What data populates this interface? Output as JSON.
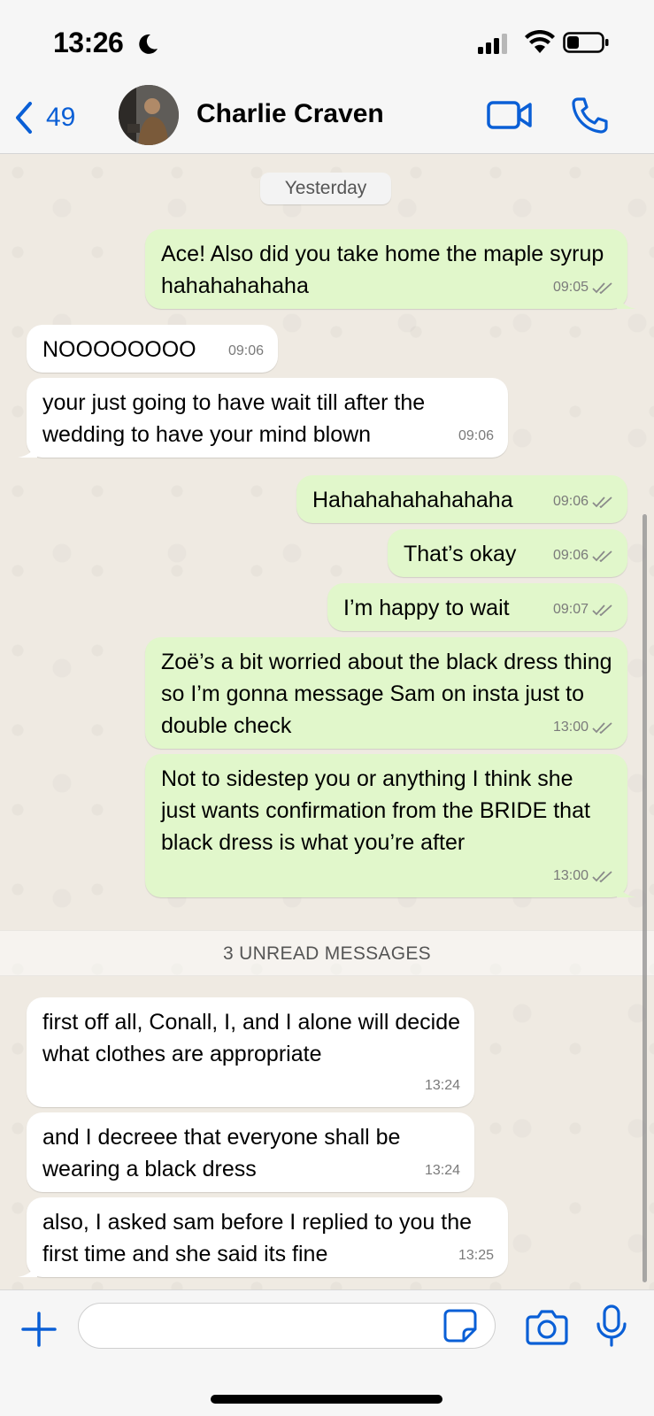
{
  "status_bar": {
    "time": "13:26"
  },
  "header": {
    "back_count": "49",
    "contact_name": "Charlie Craven"
  },
  "chat": {
    "date_chip": "Yesterday",
    "unread_label": "3 UNREAD MESSAGES",
    "messages": [
      {
        "direction": "out",
        "text": "Ace! Also did you take home the maple syrup hahahahahaha",
        "time": "09:05",
        "read": true
      },
      {
        "direction": "in",
        "text": "NOOOOOOOO",
        "time": "09:06"
      },
      {
        "direction": "in",
        "text": "your just going to have wait till after the wedding to have your mind blown",
        "time": "09:06"
      },
      {
        "direction": "out",
        "text": "Hahahahahahahaha",
        "time": "09:06",
        "read": true
      },
      {
        "direction": "out",
        "text": "That’s okay",
        "time": "09:06",
        "read": true
      },
      {
        "direction": "out",
        "text": "I’m happy to wait",
        "time": "09:07",
        "read": true
      },
      {
        "direction": "out",
        "text": "Zoë’s a bit worried about the black dress thing so I’m gonna message Sam on insta just to double check",
        "time": "13:00",
        "read": true
      },
      {
        "direction": "out",
        "text": "Not to sidestep you or anything I think she just wants confirmation from the BRIDE that black dress is what you’re after",
        "time": "13:00",
        "read": true
      },
      {
        "direction": "in",
        "text": "first off all, Conall, I, and I alone will decide what clothes are appropriate",
        "time": "13:24"
      },
      {
        "direction": "in",
        "text": "and I decreee that everyone shall be wearing a black dress",
        "time": "13:24"
      },
      {
        "direction": "in",
        "text": "also, I asked sam before I replied to you the first time and she said its fine",
        "time": "13:25"
      }
    ]
  },
  "input": {
    "value": "",
    "placeholder": ""
  },
  "colors": {
    "accent": "#0a5fd6",
    "outgoing_bubble": "#e1f7cb",
    "incoming_bubble": "#ffffff",
    "chat_background": "#efeae2"
  }
}
